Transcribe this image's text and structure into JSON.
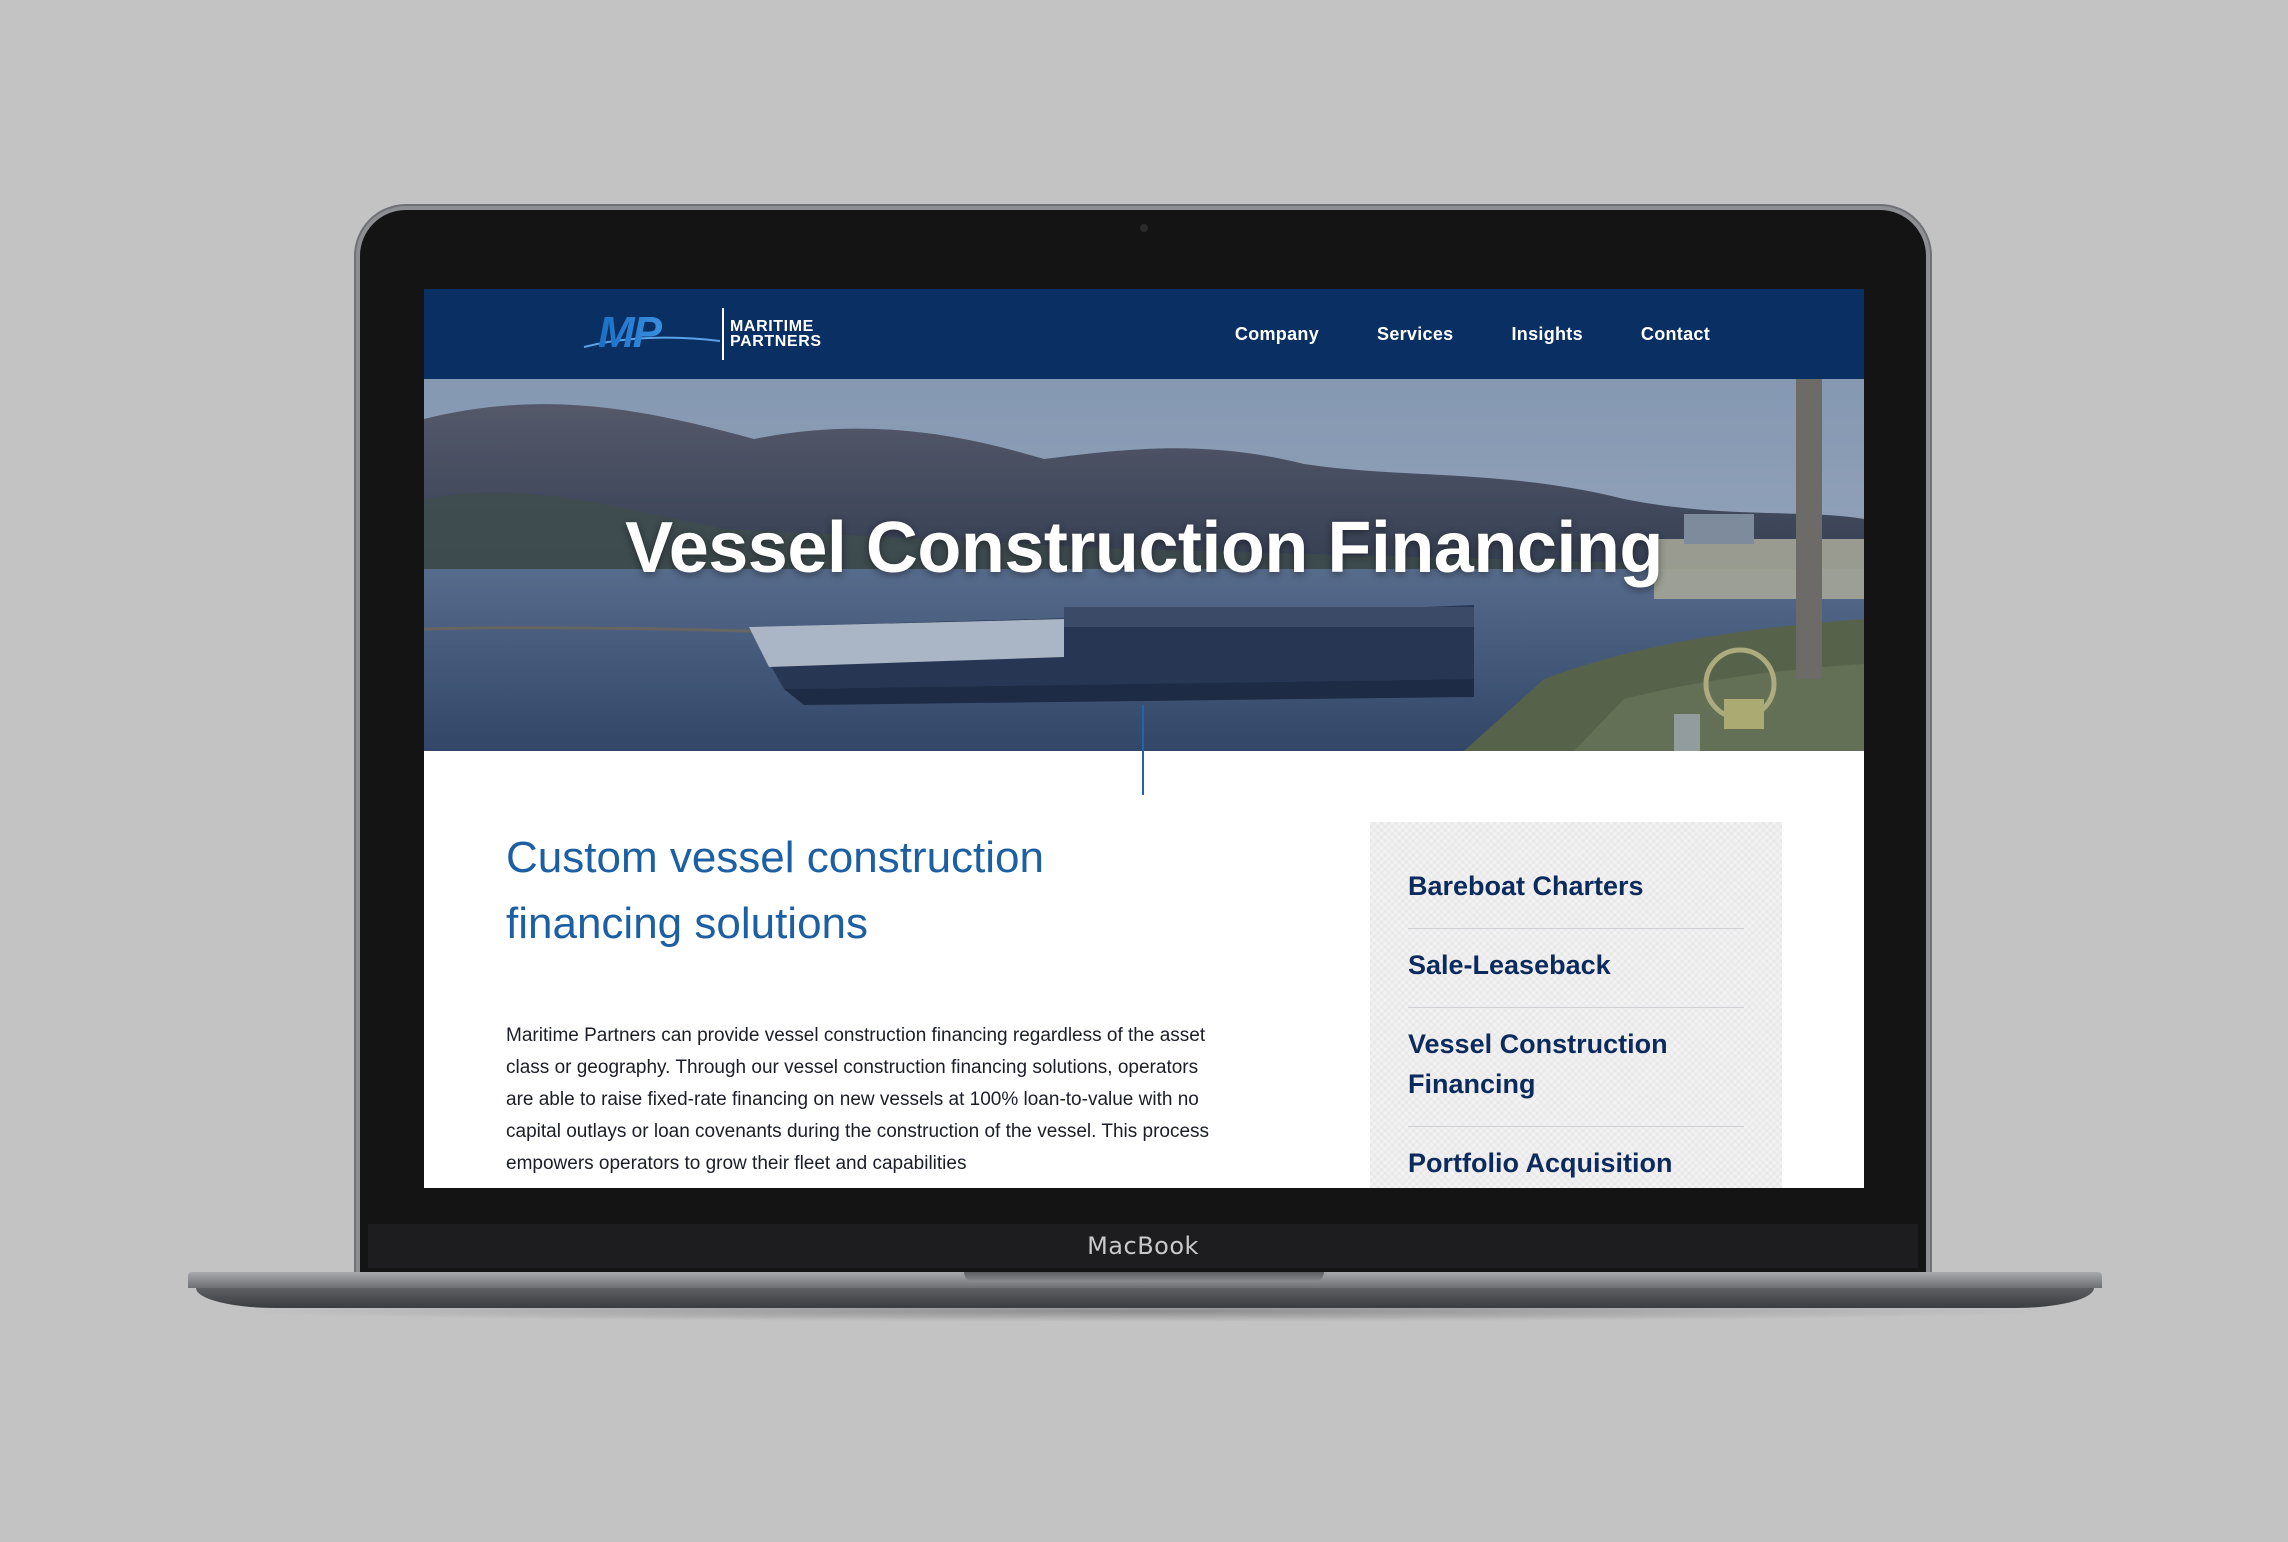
{
  "device": {
    "label": "MacBook"
  },
  "site": {
    "logo": {
      "mark": "MP",
      "line1": "MARITIME",
      "line2": "PARTNERS"
    },
    "nav": [
      "Company",
      "Services",
      "Insights",
      "Contact"
    ],
    "hero": {
      "title": "Vessel Construction Financing"
    },
    "content": {
      "heading": "Custom vessel construction financing solutions",
      "body": "Maritime Partners can provide vessel construction financing regardless of the asset class or geography. Through our vessel construction financing solutions, operators are able to raise fixed-rate financing on new vessels at 100% loan-to-value with no capital outlays or loan covenants during the construction of the vessel. This process empowers operators to grow their fleet and capabilities"
    },
    "sidebar": {
      "items": [
        "Bareboat Charters",
        "Sale-Leaseback",
        "Vessel Construction Financing",
        "Portfolio Acquisition"
      ]
    },
    "colors": {
      "header": "#0a2f63",
      "accent": "#1d5fa3",
      "sidebar_text": "#0c2a5c"
    }
  }
}
